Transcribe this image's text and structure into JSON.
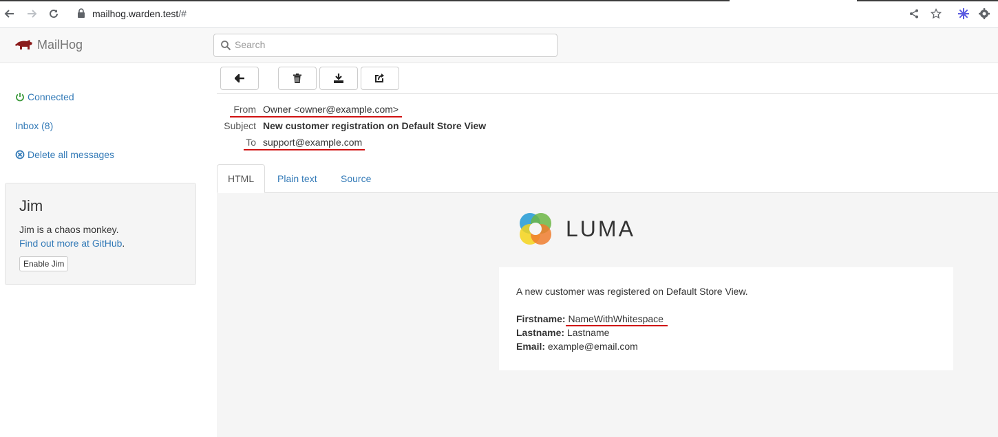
{
  "browser": {
    "url_host": "mailhog.warden.test",
    "url_path": "/#",
    "icons": [
      "back-icon",
      "forward-icon",
      "reload-icon",
      "lock-icon",
      "share-icon",
      "star-icon",
      "extension-icon",
      "settings-icon"
    ]
  },
  "app": {
    "brand": "MailHog",
    "search_placeholder": "Search"
  },
  "sidebar": {
    "connected": "Connected",
    "inbox": "Inbox (8)",
    "delete_all": "Delete all messages"
  },
  "jim": {
    "title": "Jim",
    "desc": "Jim is a chaos monkey.",
    "link": "Find out more at GitHub",
    "link_suffix": ".",
    "button": "Enable Jim"
  },
  "message": {
    "from_label": "From",
    "from_value": "Owner <owner@example.com>",
    "subject_label": "Subject",
    "subject_value": "New customer registration on Default Store View",
    "to_label": "To",
    "to_value": "support@example.com"
  },
  "tabs": {
    "html": "HTML",
    "plain": "Plain text",
    "source": "Source"
  },
  "email": {
    "logo_text": "LUMA",
    "intro": "A new customer was registered on Default Store View.",
    "firstname_label": "Firstname:",
    "firstname_value": "NameWithWhitespace",
    "lastname_label": "Lastname:",
    "lastname_value": "Lastname",
    "email_label": "Email:",
    "email_value": "example@email.com"
  },
  "colors": {
    "link": "#337ab7",
    "annotation": "#d01010",
    "brand_pig": "#8b1a1a"
  }
}
